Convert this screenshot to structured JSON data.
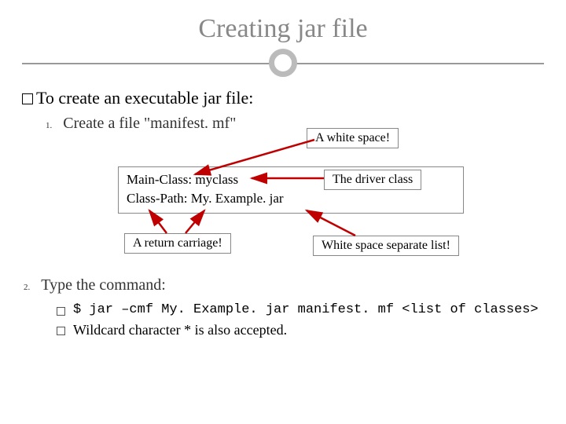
{
  "title": "Creating jar file",
  "intro": "To create an executable jar file:",
  "steps": {
    "numbers": [
      "1.",
      "2."
    ],
    "create_file": "Create a file \"manifest. mf\"",
    "type_command": "Type the command:"
  },
  "manifest": {
    "line1": "Main-Class: myclass",
    "line2": "Class-Path: My. Example. jar"
  },
  "callouts": {
    "white_space": "A white space!",
    "driver_class": "The driver class",
    "return_carriage": "A return carriage!",
    "sep_list": "White space separate list!"
  },
  "command": {
    "cmd": "$ jar –cmf My. Example. jar manifest. mf <list of classes>",
    "wildcard": "Wildcard character * is also accepted."
  }
}
